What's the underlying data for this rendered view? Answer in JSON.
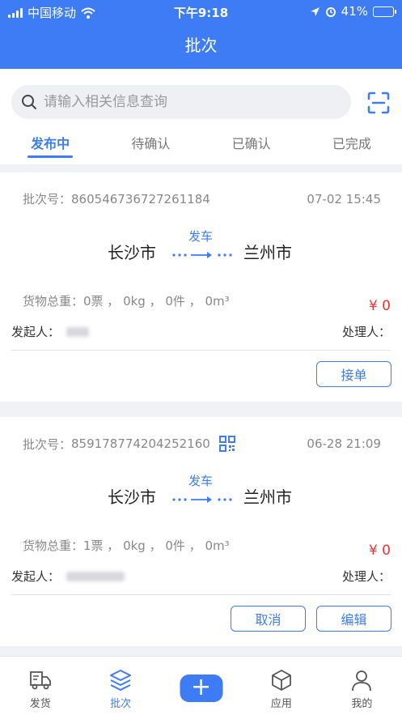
{
  "status_bar": {
    "carrier": "中国移动",
    "time": "下午9:18",
    "battery": "41%",
    "battery_level": 0.41
  },
  "header": {
    "title": "批次"
  },
  "search": {
    "placeholder": "请输入相关信息查询"
  },
  "tabs": [
    {
      "label": "发布中",
      "active": true
    },
    {
      "label": "待确认",
      "active": false
    },
    {
      "label": "已确认",
      "active": false
    },
    {
      "label": "已完成",
      "active": false
    }
  ],
  "batches": [
    {
      "batch_label": "批次号：",
      "batch_no": "860546736727261184",
      "date": "07-02 15:45",
      "from": "长沙市",
      "to": "兰州市",
      "status": "发车",
      "weight": "货物总重：0票 ， 0kg ， 0件 ， 0m³",
      "price": "¥ 0",
      "initiator_label": "发起人：",
      "handler_label": "处理人：",
      "actions": [
        "接单"
      ]
    },
    {
      "batch_label": "批次号：",
      "batch_no": "859178774204252160",
      "date": "06-28 21:09",
      "from": "长沙市",
      "to": "兰州市",
      "status": "发车",
      "weight": "货物总重：1票 ， 0kg ， 0件 ， 0m³",
      "price": "¥ 0",
      "initiator_label": "发起人：",
      "handler_label": "处理人：",
      "actions": [
        "取消",
        "编辑"
      ]
    }
  ],
  "tabbar": [
    {
      "label": "发货",
      "icon": "truck-icon"
    },
    {
      "label": "批次",
      "icon": "layers-icon",
      "active": true
    },
    {
      "label": "",
      "icon": "plus-icon"
    },
    {
      "label": "应用",
      "icon": "box-icon"
    },
    {
      "label": "我的",
      "icon": "user-icon"
    }
  ],
  "colors": {
    "primary": "#3d7cf5",
    "price": "#ee3333"
  }
}
